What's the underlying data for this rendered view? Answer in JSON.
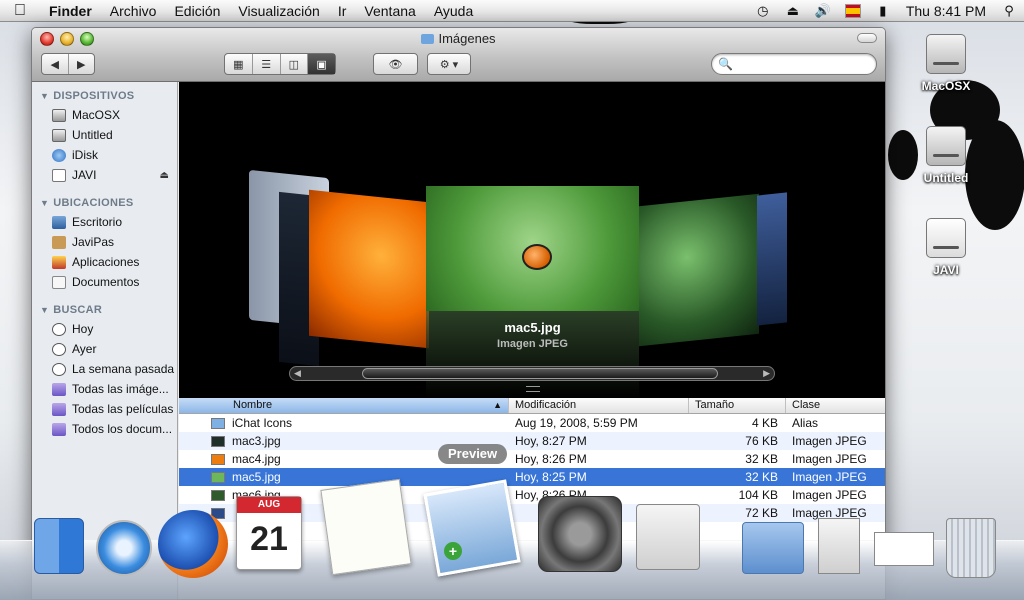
{
  "menubar": {
    "apple_icon": "apple-icon",
    "items": [
      "Finder",
      "Archivo",
      "Edición",
      "Visualización",
      "Ir",
      "Ventana",
      "Ayuda"
    ],
    "clock": "Thu 8:41 PM",
    "flag_label": "ISO"
  },
  "window": {
    "title": "Imágenes",
    "search": {
      "placeholder": ""
    }
  },
  "sidebar": {
    "sections": [
      {
        "title": "DISPOSITIVOS",
        "items": [
          {
            "label": "MacOSX",
            "icon": "hard-drive-icon"
          },
          {
            "label": "Untitled",
            "icon": "hard-drive-icon"
          },
          {
            "label": "iDisk",
            "icon": "idisk-icon"
          },
          {
            "label": "JAVI",
            "icon": "usb-drive-icon"
          }
        ]
      },
      {
        "title": "UBICACIONES",
        "items": [
          {
            "label": "Escritorio",
            "icon": "desktop-icon"
          },
          {
            "label": "JaviPas",
            "icon": "home-icon"
          },
          {
            "label": "Aplicaciones",
            "icon": "applications-icon"
          },
          {
            "label": "Documentos",
            "icon": "documents-icon"
          }
        ]
      },
      {
        "title": "BUSCAR",
        "items": [
          {
            "label": "Hoy",
            "icon": "clock-icon"
          },
          {
            "label": "Ayer",
            "icon": "clock-icon"
          },
          {
            "label": "La semana pasada",
            "icon": "clock-icon"
          },
          {
            "label": "Todas las imáge...",
            "icon": "smart-folder-icon"
          },
          {
            "label": "Todas las películas",
            "icon": "smart-folder-icon"
          },
          {
            "label": "Todos los docum...",
            "icon": "smart-folder-icon"
          }
        ]
      }
    ]
  },
  "coverflow": {
    "selected_name": "mac5.jpg",
    "selected_kind": "Imagen JPEG"
  },
  "list": {
    "columns": [
      "Nombre",
      "Modificación",
      "Tamaño",
      "Clase"
    ],
    "rows": [
      {
        "name": "iChat Icons",
        "date": "Aug 19, 2008, 5:59 PM",
        "size": "4 KB",
        "kind": "Alias"
      },
      {
        "name": "mac3.jpg",
        "date": "Hoy, 8:27 PM",
        "size": "76 KB",
        "kind": "Imagen JPEG"
      },
      {
        "name": "mac4.jpg",
        "date": "Hoy, 8:26 PM",
        "size": "32 KB",
        "kind": "Imagen JPEG"
      },
      {
        "name": "mac5.jpg",
        "date": "Hoy, 8:25 PM",
        "size": "32 KB",
        "kind": "Imagen JPEG"
      },
      {
        "name": "mac6.jpg",
        "date": "Hoy, 8:26 PM",
        "size": "104 KB",
        "kind": "Imagen JPEG"
      },
      {
        "name": "",
        "date": "",
        "size": "72 KB",
        "kind": "Imagen JPEG"
      }
    ]
  },
  "desktop": {
    "icons": [
      "MacOSX",
      "Untitled",
      "JAVI"
    ]
  },
  "dock": {
    "tooltip": "Preview",
    "calendar_month": "AUG",
    "calendar_day": "21"
  },
  "colors": {
    "selection": "#3875d7",
    "alt_row": "#edf3fe",
    "sidebar_bg": "#e8ecf1"
  }
}
